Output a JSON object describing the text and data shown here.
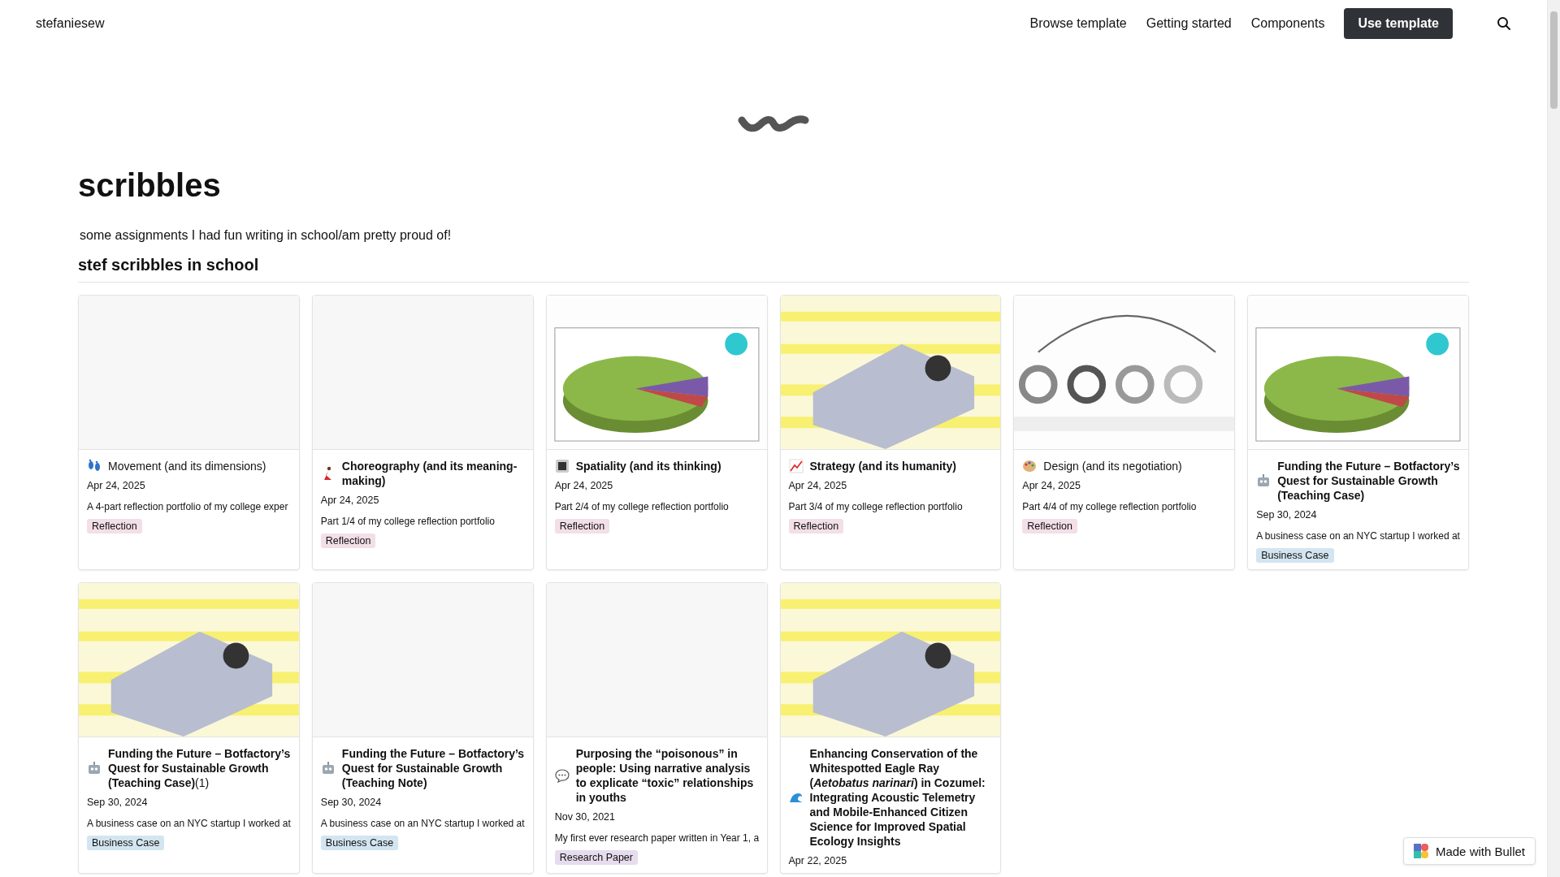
{
  "nav": {
    "brand": "stefaniesew",
    "links": [
      {
        "label": "Browse template"
      },
      {
        "label": "Getting started"
      },
      {
        "label": "Components"
      }
    ],
    "cta": "Use template"
  },
  "page": {
    "title": "scribbles",
    "subtitle": "some assignments I had fun writing in school/am pretty proud of!",
    "section": "stef scribbles in school"
  },
  "cards": [
    {
      "title": "Movement (and its dimensions)",
      "bold": false,
      "date": "Apr 24, 2025",
      "description": "A 4-part reflection portfolio of my college exper",
      "tag": {
        "label": "Reflection",
        "color": "#f3dfe8"
      }
    },
    {
      "title": "Choreography (and its meaning-making)",
      "bold": true,
      "date": "Apr 24, 2025",
      "description": "Part 1/4 of my college reflection portfolio",
      "tag": {
        "label": "Reflection",
        "color": "#f3dfe8"
      }
    },
    {
      "title": "Spatiality (and its thinking)",
      "bold": true,
      "date": "Apr 24, 2025",
      "description": "Part 2/4 of my college reflection portfolio",
      "tag": {
        "label": "Reflection",
        "color": "#f3dfe8"
      }
    },
    {
      "title": "Strategy (and its humanity)",
      "bold": true,
      "date": "Apr 24, 2025",
      "description": "Part 3/4 of my college reflection portfolio",
      "tag": {
        "label": "Reflection",
        "color": "#f3dfe8"
      }
    },
    {
      "title": "Design (and its negotiation)",
      "bold": false,
      "date": "Apr 24, 2025",
      "description": "Part 4/4 of my college reflection portfolio",
      "tag": {
        "label": "Reflection",
        "color": "#f3dfe8"
      }
    },
    {
      "title": "Funding the Future – Botfactory’s Quest for Sustainable Growth (Teaching Case)",
      "bold": true,
      "date": "Sep 30, 2024",
      "description": "A business case on an NYC startup I worked at",
      "tag": {
        "label": "Business Case",
        "color": "#d3e5f0"
      }
    },
    {
      "title": "Funding the Future – Botfactory’s Quest for Sustainable Growth (Teaching Case)",
      "suffix": "(1)",
      "bold": true,
      "date": "Sep 30, 2024",
      "description": "A business case on an NYC startup I worked at",
      "tag": {
        "label": "Business Case",
        "color": "#d3e5f0"
      }
    },
    {
      "title": "Funding the Future – Botfactory’s Quest for Sustainable Growth (Teaching Note)",
      "bold": true,
      "date": "Sep 30, 2024",
      "description": "A business case on an NYC startup I worked at",
      "tag": {
        "label": "Business Case",
        "color": "#d3e5f0"
      }
    },
    {
      "title": "Purposing the “poisonous” in people: Using narrative analysis to explicate “toxic” relationships in youths",
      "bold": true,
      "date": "Nov 30, 2021",
      "description": "My first ever research paper written in Year 1, a",
      "tag": {
        "label": "Research Paper",
        "color": "#e6dcee"
      }
    },
    {
      "title": "Enhancing Conservation of the Whitespotted Eagle Ray (*Aetobatus narinari*) in Cozumel: Integrating Acoustic Telemetry and Mobile-Enhanced Citizen Science for Improved Spatial Ecology Insights",
      "bold": true,
      "date": "Apr 22, 2025"
    }
  ],
  "badge": {
    "label": "Made with Bullet"
  }
}
